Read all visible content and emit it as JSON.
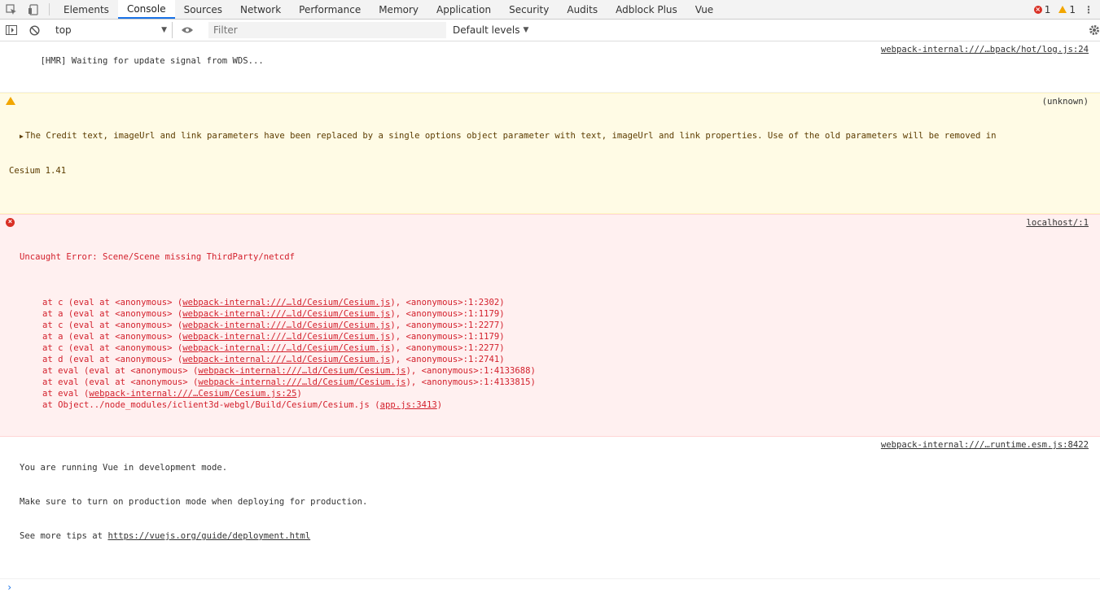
{
  "tabs": [
    "Elements",
    "Console",
    "Sources",
    "Network",
    "Performance",
    "Memory",
    "Application",
    "Security",
    "Audits",
    "Adblock Plus",
    "Vue"
  ],
  "active_tab": "Console",
  "counts": {
    "errors": "1",
    "warnings": "1"
  },
  "toolbar": {
    "context": "top",
    "filter_placeholder": "Filter",
    "levels": "Default levels"
  },
  "messages": {
    "hmr": {
      "text": "[HMR] Waiting for update signal from WDS...",
      "source": "webpack-internal:///…bpack/hot/log.js:24"
    },
    "warn": {
      "line1": "The Credit text, imageUrl and link parameters have been replaced by a single options object parameter with text, imageUrl and link properties. Use of the old parameters will be removed in",
      "line2": "Cesium 1.41",
      "source": "(unknown)"
    },
    "error": {
      "title": "Uncaught Error: Scene/Scene missing ThirdParty/netcdf",
      "source": "localhost/:1",
      "frames": [
        {
          "pre": "at c (eval at <anonymous> (",
          "link": "webpack-internal:///…ld/Cesium/Cesium.js",
          "post": "), <anonymous>:1:2302)"
        },
        {
          "pre": "at a (eval at <anonymous> (",
          "link": "webpack-internal:///…ld/Cesium/Cesium.js",
          "post": "), <anonymous>:1:1179)"
        },
        {
          "pre": "at c (eval at <anonymous> (",
          "link": "webpack-internal:///…ld/Cesium/Cesium.js",
          "post": "), <anonymous>:1:2277)"
        },
        {
          "pre": "at a (eval at <anonymous> (",
          "link": "webpack-internal:///…ld/Cesium/Cesium.js",
          "post": "), <anonymous>:1:1179)"
        },
        {
          "pre": "at c (eval at <anonymous> (",
          "link": "webpack-internal:///…ld/Cesium/Cesium.js",
          "post": "), <anonymous>:1:2277)"
        },
        {
          "pre": "at d (eval at <anonymous> (",
          "link": "webpack-internal:///…ld/Cesium/Cesium.js",
          "post": "), <anonymous>:1:2741)"
        },
        {
          "pre": "at eval (eval at <anonymous> (",
          "link": "webpack-internal:///…ld/Cesium/Cesium.js",
          "post": "), <anonymous>:1:4133688)"
        },
        {
          "pre": "at eval (eval at <anonymous> (",
          "link": "webpack-internal:///…ld/Cesium/Cesium.js",
          "post": "), <anonymous>:1:4133815)"
        },
        {
          "pre": "at eval (",
          "link": "webpack-internal:///…Cesium/Cesium.js:25",
          "post": ")"
        },
        {
          "pre": "at Object../node_modules/iclient3d-webgl/Build/Cesium/Cesium.js (",
          "link": "app.js:3413",
          "post": ")"
        }
      ]
    },
    "vue": {
      "line1": "You are running Vue in development mode.",
      "line2": "Make sure to turn on production mode when deploying for production.",
      "line3_pre": "See more tips at ",
      "line3_link": "https://vuejs.org/guide/deployment.html",
      "source": "webpack-internal:///…runtime.esm.js:8422"
    }
  },
  "prompt_symbol": "›"
}
